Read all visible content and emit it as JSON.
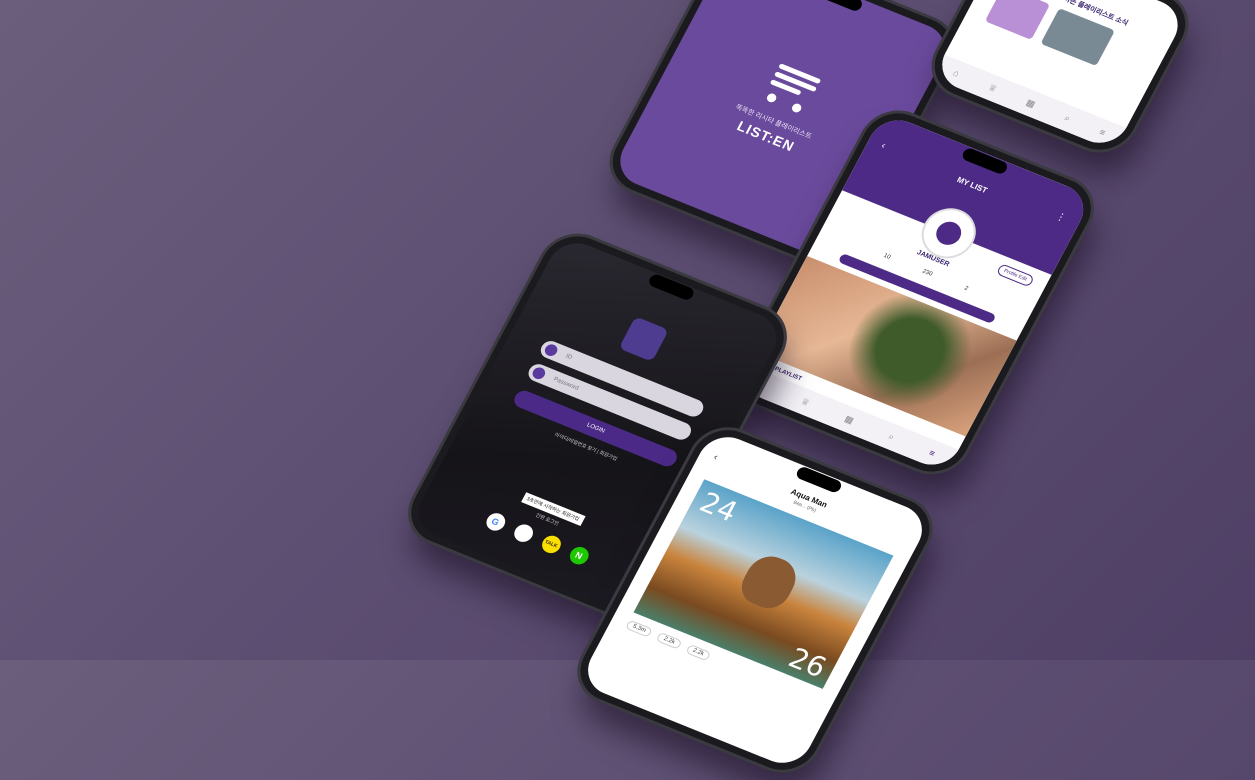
{
  "splash": {
    "tagline": "똑똑한 리시타 플레이리스트",
    "brand": "LIST:EN"
  },
  "home": {
    "title": "행복하게 하는 플레이리스트 소식",
    "tabs": [
      "home-icon",
      "trophy-icon",
      "grid-icon",
      "search-icon",
      "list-icon"
    ]
  },
  "mylist": {
    "title": "MY LIST",
    "profile_button": "Profile Edit",
    "username": "JAMUSER",
    "stats": [
      "10",
      "230",
      "2"
    ],
    "section": "MY PLAYLIST"
  },
  "login": {
    "id_placeholder": "ID",
    "pw_placeholder": "Password",
    "login_label": "LOGIN",
    "links": "아이디/비밀번호 찾기  |  회원가입",
    "banner": "3초만에 시작하는 회원가입",
    "easy_login": "간편 로그인",
    "socials": [
      {
        "label": "G",
        "bg": "#ffffff",
        "fg": "#4285f4"
      },
      {
        "label": "",
        "bg": "#ffffff",
        "fg": "#000000"
      },
      {
        "label": "TALK",
        "bg": "#f9e000",
        "fg": "#3a1d1d"
      },
      {
        "label": "N",
        "bg": "#1ec800",
        "fg": "#ffffff"
      }
    ]
  },
  "player": {
    "title": "Aqua Man",
    "artist": "Bea... (Pb)",
    "numbers": [
      "24",
      "26"
    ],
    "stats": [
      "5.3m",
      "2.2k",
      "2.2k"
    ]
  }
}
